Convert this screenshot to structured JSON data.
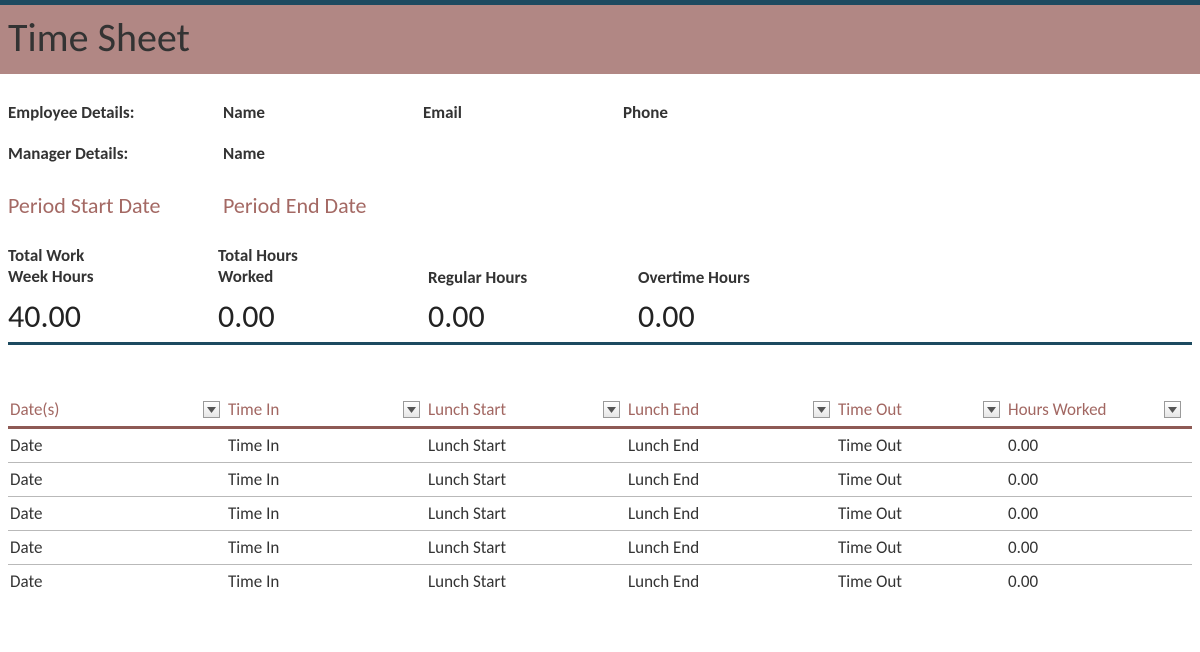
{
  "title": "Time Sheet",
  "info": {
    "employee_label": "Employee Details:",
    "employee_name_label": "Name",
    "employee_email_label": "Email",
    "employee_phone_label": "Phone",
    "manager_label": "Manager Details:",
    "manager_name_label": "Name"
  },
  "period": {
    "start_label": "Period Start Date",
    "end_label": "Period End Date"
  },
  "summary": {
    "total_week_label": "Total Work\nWeek Hours",
    "total_week_value": "40.00",
    "total_worked_label": "Total Hours\nWorked",
    "total_worked_value": "0.00",
    "regular_label": "Regular Hours",
    "regular_value": "0.00",
    "overtime_label": "Overtime Hours",
    "overtime_value": "0.00"
  },
  "table": {
    "headers": {
      "dates": "Date(s)",
      "time_in": "Time In",
      "lunch_start": "Lunch Start",
      "lunch_end": "Lunch End",
      "time_out": "Time Out",
      "hours_worked": "Hours Worked"
    },
    "rows": [
      {
        "date": "Date",
        "time_in": "Time In",
        "lunch_start": "Lunch Start",
        "lunch_end": "Lunch End",
        "time_out": "Time Out",
        "hours_worked": "0.00"
      },
      {
        "date": "Date",
        "time_in": "Time In",
        "lunch_start": "Lunch Start",
        "lunch_end": "Lunch End",
        "time_out": "Time Out",
        "hours_worked": "0.00"
      },
      {
        "date": "Date",
        "time_in": "Time In",
        "lunch_start": "Lunch Start",
        "lunch_end": "Lunch End",
        "time_out": "Time Out",
        "hours_worked": "0.00"
      },
      {
        "date": "Date",
        "time_in": "Time In",
        "lunch_start": "Lunch Start",
        "lunch_end": "Lunch End",
        "time_out": "Time Out",
        "hours_worked": "0.00"
      },
      {
        "date": "Date",
        "time_in": "Time In",
        "lunch_start": "Lunch Start",
        "lunch_end": "Lunch End",
        "time_out": "Time Out",
        "hours_worked": "0.00"
      }
    ]
  }
}
